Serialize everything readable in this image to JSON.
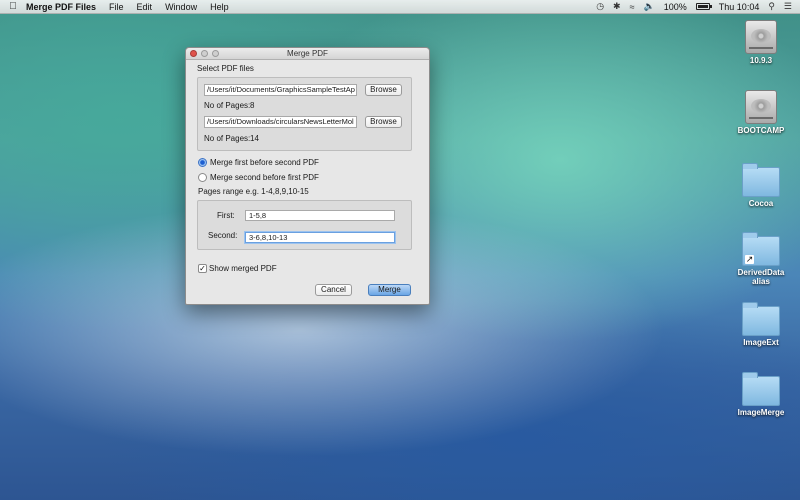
{
  "menubar": {
    "app_name": "Merge PDF Files",
    "menus": [
      "File",
      "Edit",
      "Window",
      "Help"
    ],
    "battery": "100%",
    "clock": "Thu 10:04"
  },
  "window": {
    "title": "Merge PDF",
    "select_label": "Select PDF files",
    "file1": {
      "path": "/Users/it/Documents/GraphicsSampleTestAp",
      "browse": "Browse",
      "pages_label": "No of Pages:",
      "pages": "8"
    },
    "file2": {
      "path": "/Users/it/Downloads/circularsNewsLetterMol",
      "browse": "Browse",
      "pages_label": "No of Pages:",
      "pages": "14"
    },
    "option_first": "Merge first before second PDF",
    "option_second": "Merge second before first PDF",
    "range_hint": "Pages range e.g. 1-4,8,9,10-15",
    "first_label": "First:",
    "first_value": "1-5,8",
    "second_label": "Second:",
    "second_value": "3-6,8,10-13",
    "show_merged": "Show merged PDF",
    "cancel": "Cancel",
    "merge": "Merge"
  },
  "desktop": {
    "icons": [
      {
        "label": "10.9.3",
        "kind": "disk-icon"
      },
      {
        "label": "BOOTCAMP",
        "kind": "disk-icon"
      },
      {
        "label": "Cocoa",
        "kind": "folder-icon"
      },
      {
        "label": "DerivedData alias",
        "line1": "DerivedData",
        "line2": "alias",
        "kind": "folder-alias-icon"
      },
      {
        "label": "ImageExt",
        "kind": "folder-icon"
      },
      {
        "label": "ImageMerge",
        "kind": "folder-icon"
      }
    ]
  }
}
